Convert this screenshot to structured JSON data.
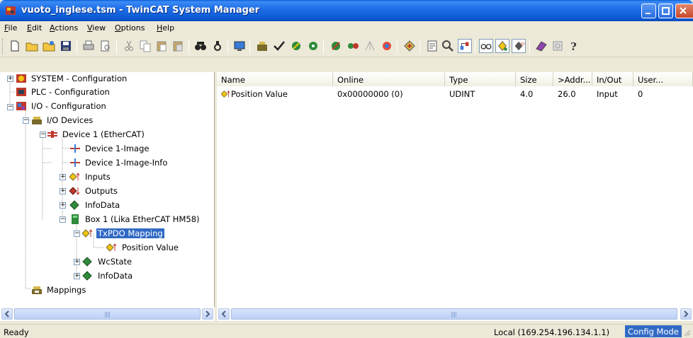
{
  "window": {
    "title": "vuoto_inglese.tsm - TwinCAT System Manager"
  },
  "menu": [
    {
      "label": "File",
      "accel": "F"
    },
    {
      "label": "Edit",
      "accel": "E"
    },
    {
      "label": "Actions",
      "accel": "A"
    },
    {
      "label": "View",
      "accel": "V"
    },
    {
      "label": "Options",
      "accel": "O"
    },
    {
      "label": "Help",
      "accel": "H"
    }
  ],
  "toolbar": {
    "icons": [
      "new-icon",
      "open-icon",
      "open-project-icon",
      "save-icon",
      "print-icon",
      "print-preview-icon",
      "cut-icon",
      "copy-icon",
      "paste-icon",
      "paste-with-links-icon",
      "find-icon",
      "find-next-icon",
      "view-target-icon",
      "append-device-icon",
      "check-config-icon",
      "activate-config-icon",
      "set-free-run-icon",
      "reload-devices-icon",
      "scan-devices-icon",
      "toggle-free-run-icon",
      "config-mode-icon",
      "goto-link-icon",
      "show-online-icon",
      "zoom-icon",
      "mapping-icon",
      "watch-icon",
      "add-to-watch-icon",
      "force-icon",
      "help-about-icon",
      "settings-icon",
      "help-icon"
    ]
  },
  "tree": {
    "items": [
      {
        "label": "SYSTEM - Configuration",
        "icon": "system-config-icon"
      },
      {
        "label": "PLC - Configuration",
        "icon": "plc-config-icon"
      },
      {
        "label": "I/O - Configuration",
        "icon": "io-config-icon"
      },
      {
        "label": "I/O Devices",
        "icon": "io-devices-icon"
      },
      {
        "label": "Device 1 (EtherCAT)",
        "icon": "ethercat-device-icon"
      },
      {
        "label": "Device 1-Image",
        "icon": "process-image-icon"
      },
      {
        "label": "Device 1-Image-Info",
        "icon": "process-image-icon"
      },
      {
        "label": "Inputs",
        "icon": "inputs-icon"
      },
      {
        "label": "Outputs",
        "icon": "outputs-icon"
      },
      {
        "label": "InfoData",
        "icon": "infodata-icon"
      },
      {
        "label": "Box 1 (Lika EtherCAT HM58)",
        "icon": "box-icon"
      },
      {
        "label": "TxPDO Mapping",
        "icon": "txpdo-icon"
      },
      {
        "label": "Position Value",
        "icon": "variable-input-icon"
      },
      {
        "label": "WcState",
        "icon": "infodata-icon"
      },
      {
        "label": "InfoData",
        "icon": "infodata-icon"
      },
      {
        "label": "Mappings",
        "icon": "mappings-icon"
      }
    ],
    "selected": "TxPDO Mapping"
  },
  "list": {
    "columns": [
      "Name",
      "Online",
      "Type",
      "Size",
      ">Addr...",
      "In/Out",
      "User..."
    ],
    "rows": [
      {
        "name": "Position Value",
        "online": "0x00000000 (0)",
        "type": "UDINT",
        "size": "4.0",
        "addr": "26.0",
        "inout": "Input",
        "user": "0"
      }
    ]
  },
  "status": {
    "ready": "Ready",
    "local": "Local (169.254.196.134.1.1)",
    "mode": "Config Mode"
  },
  "colors": {
    "titlebar": "#0b58d3",
    "selection": "#316ac5",
    "window_bg": "#ece9d8"
  }
}
